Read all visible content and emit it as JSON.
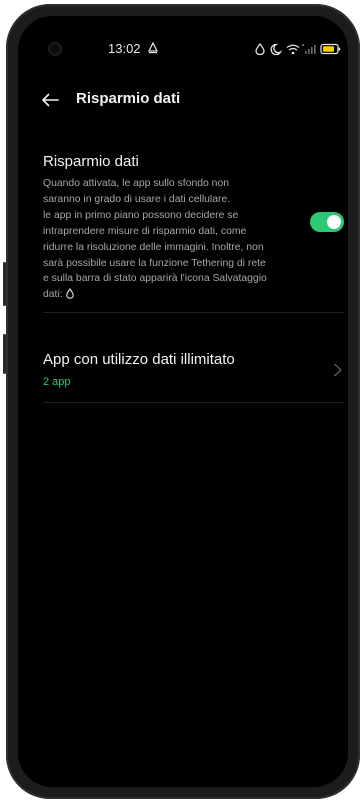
{
  "status_bar": {
    "time": "13:02",
    "notification_icon": "alert-icon",
    "icons": [
      "data-saver-icon",
      "do-not-disturb-icon",
      "wifi-icon",
      "no-signal-icon",
      "battery-icon"
    ],
    "battery_color": "#f5d000"
  },
  "header": {
    "back_icon": "arrow-left-icon",
    "title": "Risparmio dati"
  },
  "data_saver": {
    "title": "Risparmio dati",
    "description": "Quando attivata, le app sullo sfondo non\nsaranno in grado di usare i dati cellulare.\nle app in primo piano possono decidere se\nintraprendere misure di risparmio dati, come\nridurre la risoluzione delle immagini. Inoltre, non\nsarà possibile usare la funzione Tethering di rete\ne sulla barra di stato apparirà l'icona Salvataggio\ndati:",
    "description_icon": "data-saver-icon",
    "enabled": true
  },
  "unlimited_data": {
    "title": "App con utilizzo dati illimitato",
    "subtitle": "2 app",
    "chevron_icon": "chevron-right-icon"
  },
  "colors": {
    "accent": "#2cc872",
    "background": "#000000",
    "text_primary": "#f2f2f2",
    "text_secondary": "#a7a7a7"
  }
}
